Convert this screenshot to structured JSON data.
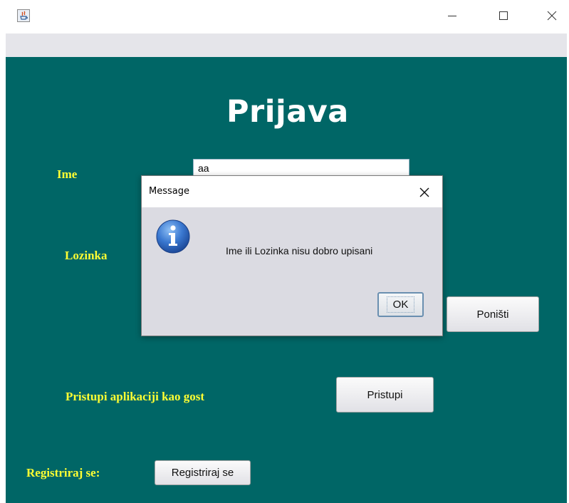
{
  "window": {
    "title": "",
    "app_icon": "java-icon",
    "controls": {
      "minimize_icon": "minimize-icon",
      "maximize_icon": "maximize-icon",
      "close_icon": "close-icon"
    }
  },
  "form": {
    "heading": "Prijava",
    "username_label": "Ime",
    "username_value": "aa",
    "password_label": "Lozinka",
    "cancel_button": "Poništi",
    "guest_label": "Pristupi aplikaciji kao gost",
    "guest_button": "Pristupi",
    "register_label": "Registriraj se:",
    "register_button": "Registriraj se"
  },
  "dialog": {
    "title": "Message",
    "icon": "info-icon",
    "message": "Ime ili Lozinka nisu dobro upisani",
    "ok_button": "OK"
  },
  "colors": {
    "panel_background": "#006666",
    "label_yellow": "#ffff33",
    "heading_white": "#ffffff",
    "dialog_background": "#dbdbe2"
  }
}
